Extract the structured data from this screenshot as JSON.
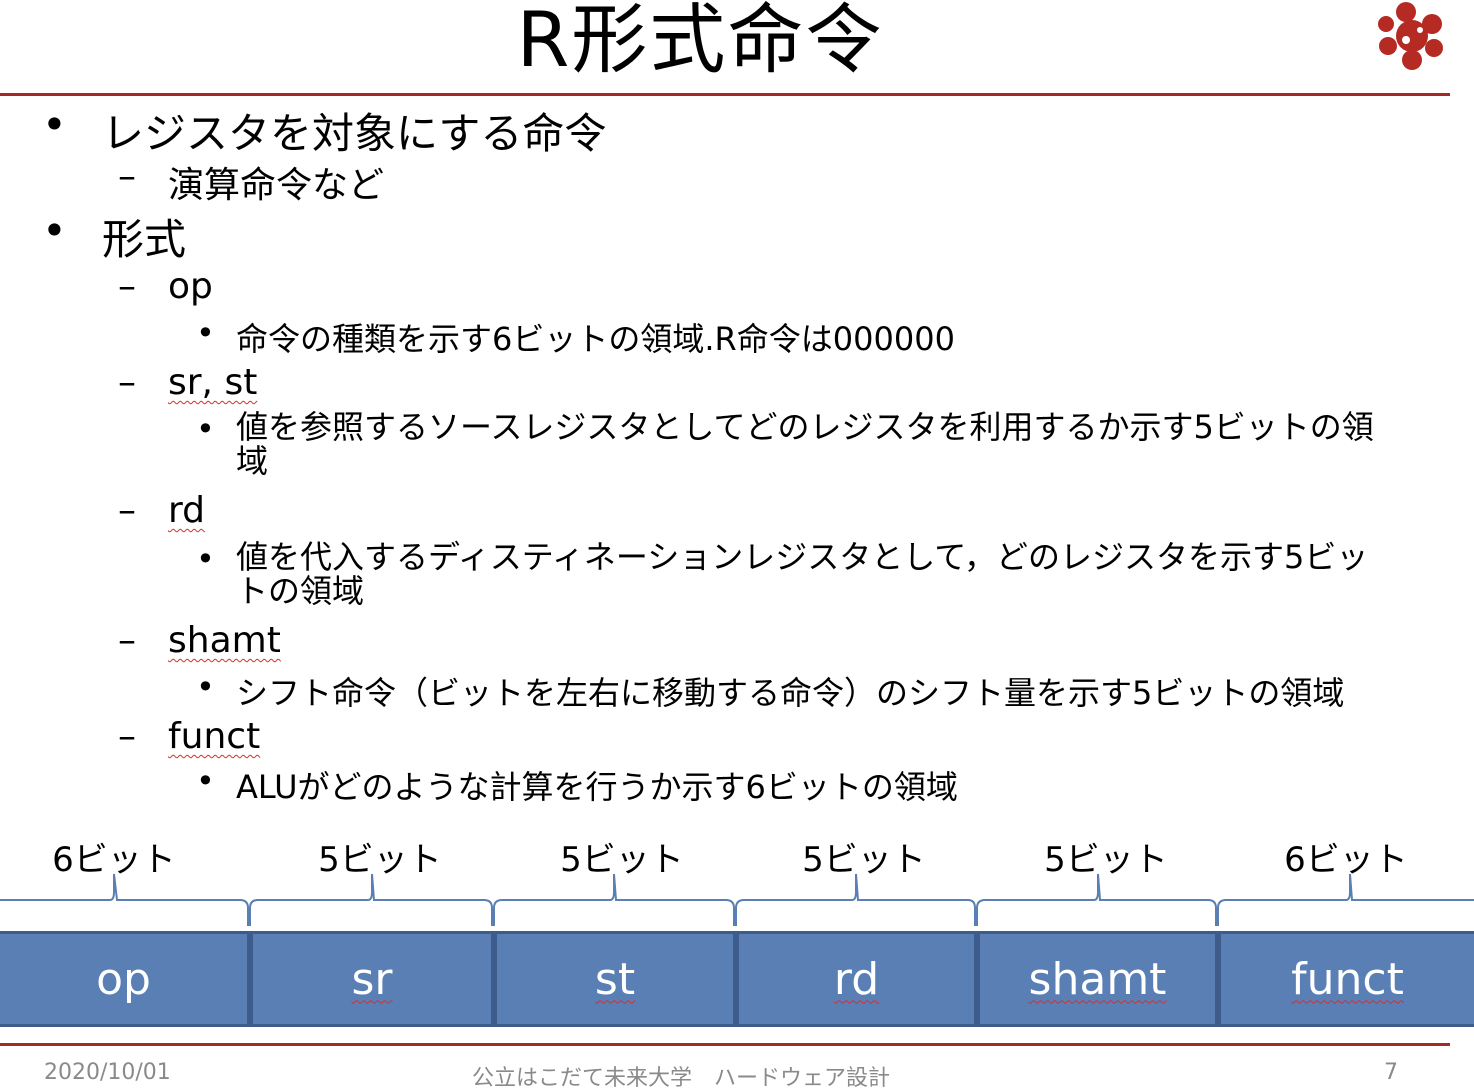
{
  "slide": {
    "title": "R形式命令",
    "accent_color": "#a52a23",
    "field_color": "#5a7fb5"
  },
  "bullets": [
    {
      "marker": "•",
      "text": "レジスタを対象にする命令"
    },
    {
      "marker": "–",
      "text": "演算命令など"
    },
    {
      "marker": "•",
      "text": "形式"
    }
  ],
  "fields_desc": [
    {
      "name": "op",
      "desc": "命令の種類を示す6ビットの領域.R命令は000000"
    },
    {
      "name": "sr, st",
      "desc": "値を参照するソースレジスタとしてどのレジスタを利用するか示す5ビットの領域"
    },
    {
      "name": "rd",
      "desc": "値を代入するディスティネーションレジスタとして，どのレジスタを示す5ビットの領域"
    },
    {
      "name": "shamt",
      "desc": "シフト命令（ビットを左右に移動する命令）のシフト量を示す5ビットの領域"
    },
    {
      "name": "funct",
      "desc": "ALUがどのような計算を行うか示す6ビットの領域"
    }
  ],
  "format": [
    {
      "bits": "6ビット",
      "name": "op"
    },
    {
      "bits": "5ビット",
      "name": "sr"
    },
    {
      "bits": "5ビット",
      "name": "st"
    },
    {
      "bits": "5ビット",
      "name": "rd"
    },
    {
      "bits": "5ビット",
      "name": "shamt"
    },
    {
      "bits": "6ビット",
      "name": "funct"
    }
  ],
  "footer": {
    "date": "2020/10/01",
    "center": "公立はこだて未来大学　ハードウェア設計",
    "page": "7"
  }
}
